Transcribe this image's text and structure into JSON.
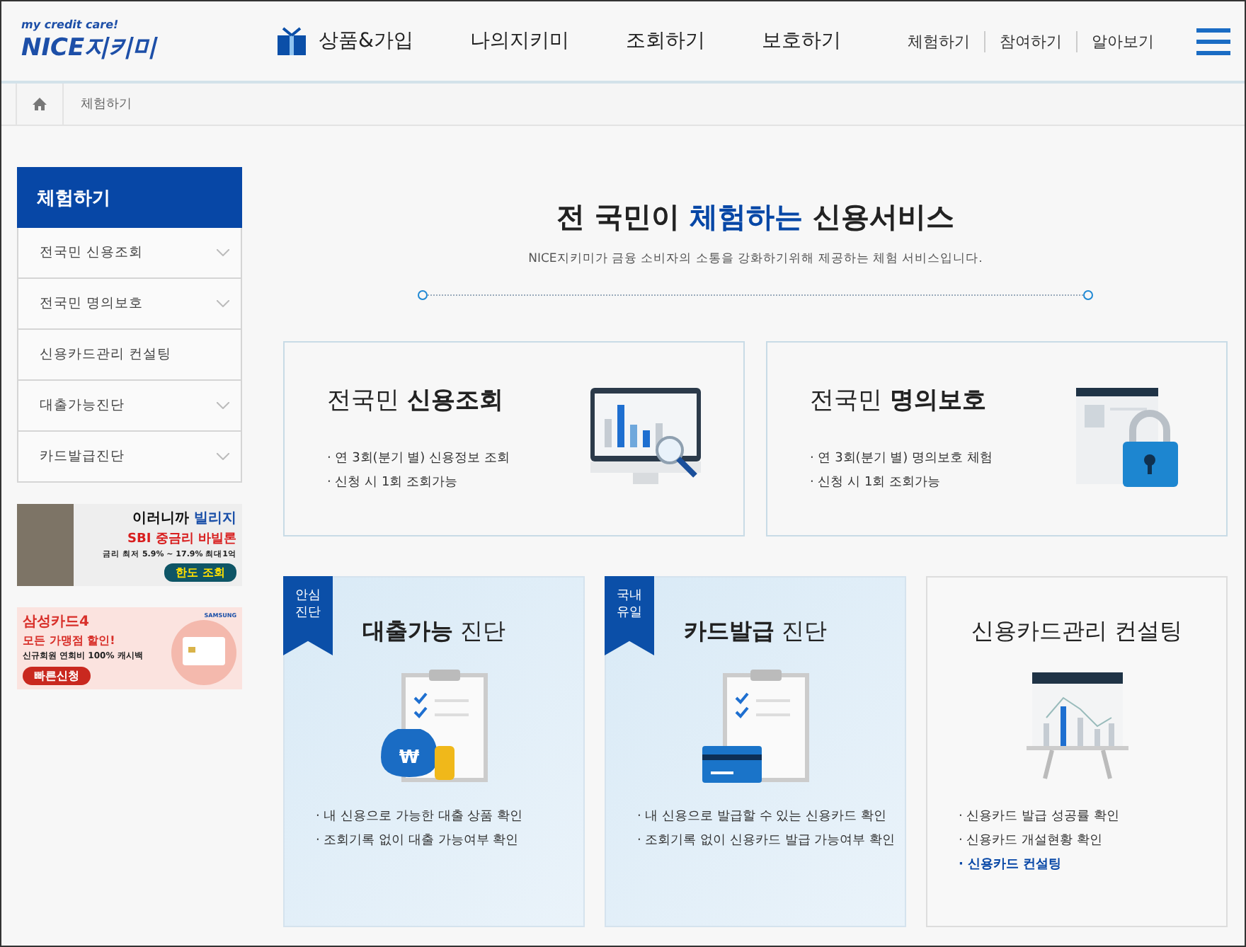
{
  "header": {
    "logo_tagline": "my credit care!",
    "logo_brand": "NICE",
    "logo_name": "지키미",
    "nav": [
      {
        "label": "상품&가입",
        "icon": true
      },
      {
        "label": "나의지키미",
        "icon": false
      },
      {
        "label": "조회하기",
        "icon": false
      },
      {
        "label": "보호하기",
        "icon": false
      }
    ],
    "utility_links": [
      "체험하기",
      "참여하기",
      "알아보기"
    ]
  },
  "breadcrumb": {
    "current": "체험하기"
  },
  "sidebar": {
    "title": "체험하기",
    "items": [
      {
        "label": "전국민 신용조회",
        "expandable": true
      },
      {
        "label": "전국민 명의보호",
        "expandable": true
      },
      {
        "label": "신용카드관리 컨설팅",
        "expandable": false
      },
      {
        "label": "대출가능진단",
        "expandable": true
      },
      {
        "label": "카드발급진단",
        "expandable": true
      }
    ],
    "banners": [
      {
        "kind": "loan",
        "line1_a": "이러니까 ",
        "line1_b": "빌리지",
        "line2": "SBI 중금리 바빌론",
        "line3": "금리 최저 5.9% ~ 17.9% 최대1억",
        "button": "한도 조회"
      },
      {
        "kind": "card",
        "brand": "SAMSUNG",
        "line1": "삼성카드4",
        "line2": "모든 가맹점 할인!",
        "line3": "신규회원 연회비 100% 캐시백",
        "button": "빠른신청"
      }
    ]
  },
  "intro": {
    "title_before": "전 국민이 ",
    "title_highlight": "체험하는",
    "title_after": " 신용서비스",
    "subtitle": "NICE지키미가 금융 소비자의 소통을 강화하기위해 제공하는 체험 서비스입니다."
  },
  "top_cards": [
    {
      "title": "전국민 **신용조회**",
      "kind": "monitor",
      "bullets": [
        "· 연 3회(분기 별) 신용정보 조회",
        "· 신청 시 1회 조회가능"
      ]
    },
    {
      "title": "전국민 **명의보호**",
      "kind": "lock",
      "bullets": [
        "· 연 3회(분기 별) 명의보호 체험",
        "· 신청 시 1회 조회가능"
      ]
    }
  ],
  "bottom_cards": [
    {
      "tag": [
        "안심",
        "진단"
      ],
      "title": "**대출가능** 진단",
      "kind": "moneybag",
      "currency_symbol": "₩",
      "highlighted": true,
      "bullets": [
        {
          "kind": "text",
          "text": "· 내 신용으로 가능한 대출 상품 확인"
        },
        {
          "kind": "text",
          "text": "· 조회기록 없이 대출 가능여부 확인"
        }
      ]
    },
    {
      "tag": [
        "국내",
        "유일"
      ],
      "title": "**카드발급** 진단",
      "kind": "card",
      "highlighted": true,
      "bullets": [
        {
          "kind": "text",
          "text": "· 내 신용으로 발급할 수 있는 신용카드 확인"
        },
        {
          "kind": "text",
          "text": "· 조회기록 없이 신용카드 발급 가능여부 확인"
        }
      ]
    },
    {
      "title": "신용카드관리 컨설팅",
      "kind": "board",
      "highlighted": false,
      "bullets": [
        {
          "kind": "text",
          "text": "· 신용카드 발급 성공률 확인"
        },
        {
          "kind": "text",
          "text": "· 신용카드 개설현황 확인"
        },
        {
          "kind": "link",
          "text": "· 신용카드 컨설팅"
        }
      ]
    }
  ]
}
